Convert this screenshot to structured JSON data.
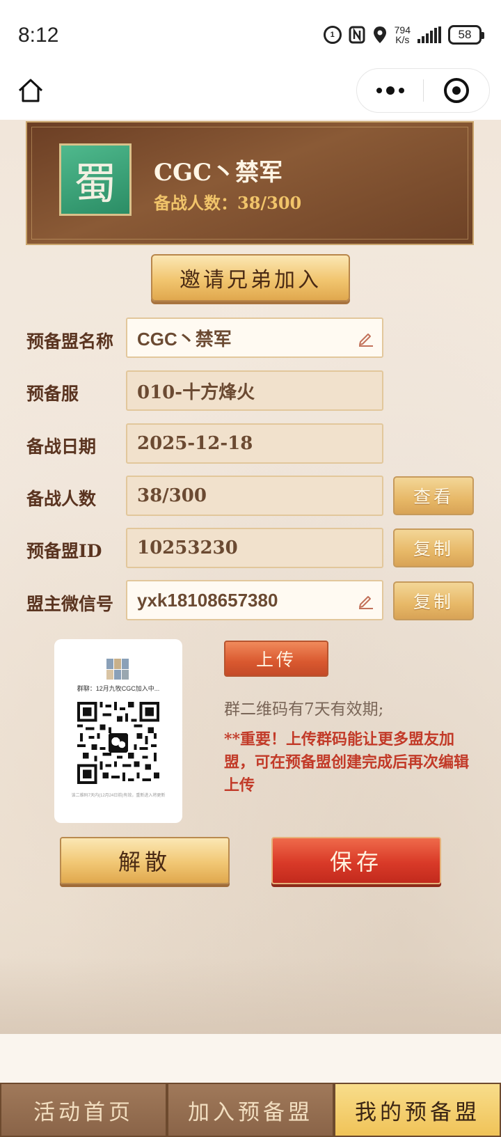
{
  "status_bar": {
    "time": "8:12",
    "speed_value": "794",
    "speed_unit": "K/s",
    "battery": "58"
  },
  "banner": {
    "kingdom_char": "蜀",
    "alliance_name": "CGC丶禁军",
    "member_count": "备战人数：38/300"
  },
  "invite_button": "邀请兄弟加入",
  "form": {
    "name_label": "预备盟名称",
    "name_value": "CGC丶禁军",
    "server_label": "预备服",
    "server_value": "010-十方烽火",
    "date_label": "备战日期",
    "date_value": "2025-12-18",
    "count_label": "备战人数",
    "count_value": "38/300",
    "view_button": "查看",
    "id_label": "预备盟ID",
    "id_value": "10253230",
    "copy_id_button": "复制",
    "wechat_label": "盟主微信号",
    "wechat_value": "yxk18108657380",
    "copy_wechat_button": "复制"
  },
  "qr": {
    "group_name": "群聊：12月九牧CGC加入中...",
    "note": "该二维码7天内(12月24日前)有效，重新进入将更新"
  },
  "upload_button": "上传",
  "qr_valid_text": "群二维码有7天有效期;",
  "important_text": "**重要！上传群码能让更多盟友加盟，可在预备盟创建完成后再次编辑上传",
  "actions": {
    "dissolve": "解散",
    "save": "保存"
  },
  "tabs": [
    {
      "label": "活动首页",
      "active": false
    },
    {
      "label": "加入预备盟",
      "active": false
    },
    {
      "label": "我的预备盟",
      "active": true
    }
  ],
  "colors": {
    "accent_gold": "#f0c358",
    "accent_red": "#d93a28",
    "shu_green": "#2b8d65"
  }
}
